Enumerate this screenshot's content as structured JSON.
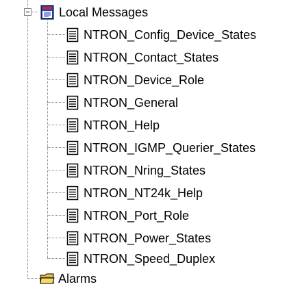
{
  "tree": {
    "parent": {
      "label": "Local Messages",
      "icon": "message-book-icon",
      "expanded": true
    },
    "children": [
      {
        "label": "NTRON_Config_Device_States",
        "icon": "document-icon"
      },
      {
        "label": "NTRON_Contact_States",
        "icon": "document-icon"
      },
      {
        "label": "NTRON_Device_Role",
        "icon": "document-icon"
      },
      {
        "label": "NTRON_General",
        "icon": "document-icon"
      },
      {
        "label": "NTRON_Help",
        "icon": "document-icon"
      },
      {
        "label": "NTRON_IGMP_Querier_States",
        "icon": "document-icon"
      },
      {
        "label": "NTRON_Nring_States",
        "icon": "document-icon"
      },
      {
        "label": "NTRON_NT24k_Help",
        "icon": "document-icon"
      },
      {
        "label": "NTRON_Port_Role",
        "icon": "document-icon"
      },
      {
        "label": "NTRON_Power_States",
        "icon": "document-icon"
      },
      {
        "label": "NTRON_Speed_Duplex",
        "icon": "document-icon"
      }
    ],
    "sibling": {
      "label": "Alarms",
      "icon": "folder-icon"
    }
  },
  "colors": {
    "connector": "#808080",
    "folder": "#e8c44a",
    "book_blue": "#1f3fbf",
    "book_red": "#c0282c"
  }
}
